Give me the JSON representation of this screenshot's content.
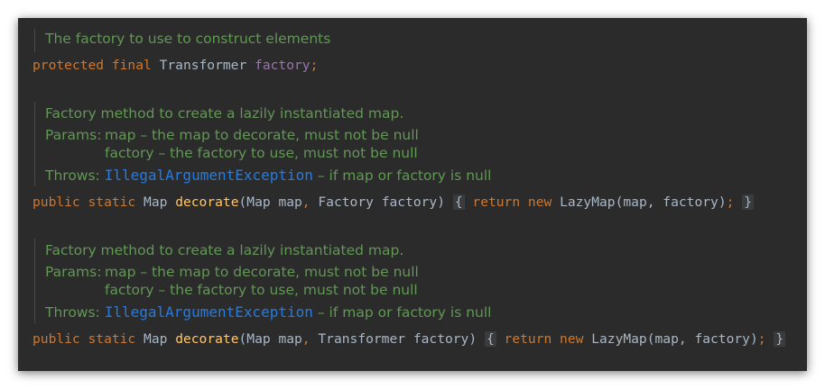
{
  "block1": {
    "doc": "The factory to use to construct elements",
    "code": {
      "kw1": "protected final",
      "type": "Transformer",
      "field": "factory",
      "semi": ";"
    }
  },
  "block2": {
    "doc_main": "Factory method to create a lazily instantiated map.",
    "params_label": "Params:",
    "param1": "map – the map to decorate, must not be null",
    "param2": "factory – the factory to use, must not be null",
    "throws_label": "Throws:",
    "exception": "IllegalArgumentException",
    "throws_desc": "– if map or factory is null",
    "code": {
      "kw": "public static",
      "rtype": "Map",
      "method": "decorate",
      "open": "(",
      "p1type": "Map",
      "p1name": "map",
      "comma": ",",
      "p2type": "Factory",
      "p2name": "factory",
      "close": ")",
      "lbrace": "{",
      "ret": "return new",
      "cls": "LazyMap",
      "args": "(map, factory)",
      "semi": ";",
      "rbrace": "}"
    }
  },
  "block3": {
    "doc_main": "Factory method to create a lazily instantiated map.",
    "params_label": "Params:",
    "param1": "map – the map to decorate, must not be null",
    "param2": "factory – the factory to use, must not be null",
    "throws_label": "Throws:",
    "exception": "IllegalArgumentException",
    "throws_desc": "– if map or factory is null",
    "code": {
      "kw": "public static",
      "rtype": "Map",
      "method": "decorate",
      "open": "(",
      "p1type": "Map",
      "p1name": "map",
      "comma": ",",
      "p2type": "Transformer",
      "p2name": "factory",
      "close": ")",
      "lbrace": "{",
      "ret": "return new",
      "cls": "LazyMap",
      "args": "(map, factory)",
      "semi": ";",
      "rbrace": "}"
    }
  }
}
